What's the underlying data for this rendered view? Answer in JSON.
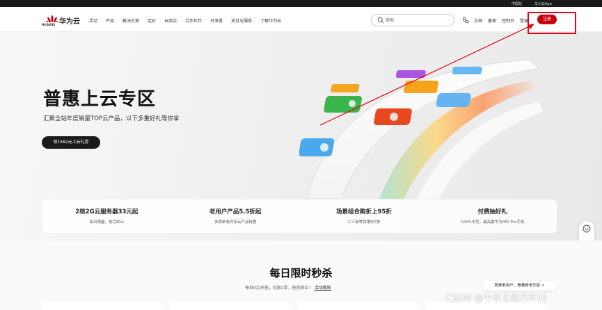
{
  "topbar": {
    "region": "中国站",
    "app": "华为云App"
  },
  "nav": {
    "brand": "HUAWEI",
    "cloud": "华为云",
    "menu": [
      "活动",
      "产品",
      "解决方案",
      "定价",
      "云商店",
      "合作伙伴",
      "开发者",
      "支持与服务",
      "了解华为云"
    ],
    "search_placeholder": "搜索",
    "links": [
      "文档",
      "备案",
      "控制台",
      "登录"
    ],
    "register": "注册"
  },
  "hero": {
    "title": "普惠上云专区",
    "subtitle": "汇聚全站年度销量TOP云产品，以下多重好礼等你拿",
    "button": "领1562元上云礼券"
  },
  "promos": [
    {
      "title": "2核2G云服务器33元起",
      "desc": "每日限量，抢完即止"
    },
    {
      "title": "老用户产品5.5折起",
      "desc": "多款新老同享云产品特惠"
    },
    {
      "title": "场景组合购折上95折",
      "desc": "二三级等保限时7折"
    },
    {
      "title": "付费抽好礼",
      "desc": "100%中奖，最高赢华为P60 Pro手机"
    }
  ],
  "section": {
    "title": "每日限时秒杀",
    "subtitle": "每日0点开抢，仅限1单，抢完即止！",
    "rules": "活动规则",
    "pill": "我是老用户，看看新老同享 >"
  },
  "watermark": "CSDN @千年王霸万年归",
  "colors": {
    "brand_red": "#c7000b",
    "annotation_red": "#e60012",
    "hero_dark_button": "#1b1b1b"
  }
}
